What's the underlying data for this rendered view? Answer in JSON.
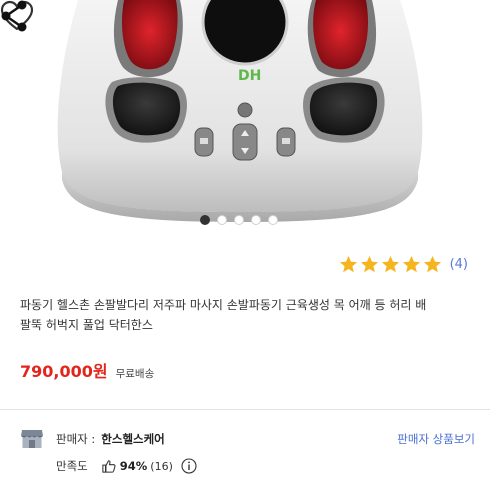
{
  "product": {
    "carousel_total": 5,
    "carousel_active": 1,
    "device_logo_text": "DH",
    "title": "파동기 헬스촌 손팔발다리 저주파 마사지 손발파동기 근육생성 목 어깨 등 허리 배 팔뚝 허벅지 풀업 닥터한스",
    "title_line1": "파동기 헬스촌 손팔발다리 저주파 마사지 손발파동기 근육생성 목 어깨 등 허리 배",
    "title_line2": "팔뚝 허벅지 풀업 닥터한스",
    "price": "790,000원",
    "shipping": "무료배송"
  },
  "rating": {
    "stars": 5,
    "max_stars": 5,
    "review_count_label": "(4)",
    "star_color": "#f6b51e"
  },
  "seller": {
    "label": "판매자 :",
    "name": "한스헬스케어",
    "products_link": "판매자 상품보기",
    "satisfaction_label": "만족도",
    "satisfaction_percent": "94%",
    "satisfaction_count": "(16)"
  },
  "icons": {
    "wishlist": "heart-outline-icon",
    "share": "share-icon",
    "seller": "store-icon",
    "satisfaction": "thumbs-up-icon",
    "info": "info-circle-icon"
  },
  "colors": {
    "price": "#e1261c",
    "link": "#4a6fd6",
    "star": "#f6b51e"
  }
}
